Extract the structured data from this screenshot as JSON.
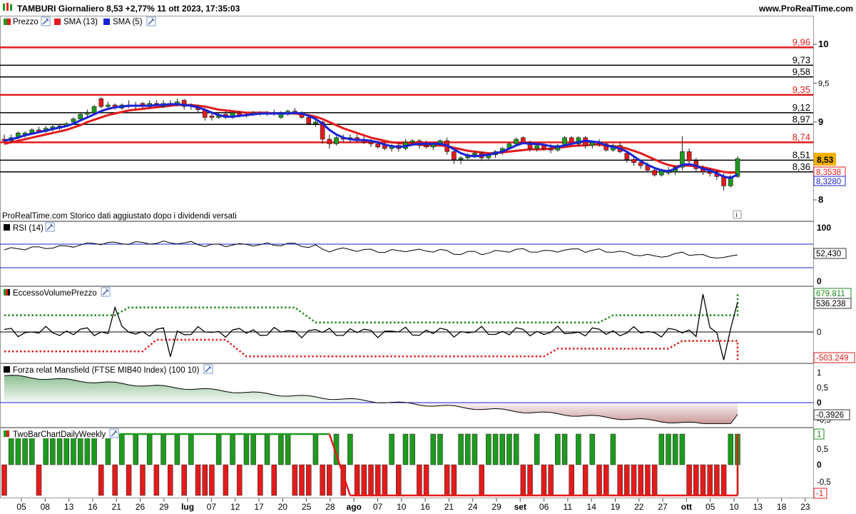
{
  "header": {
    "title": "TAMBURI Giornaliero 8,53 +2,77% 11 ott 2023, 17:35:03",
    "brand": "www.ProRealTime.com"
  },
  "legend": {
    "price": "Prezzo",
    "sma13": "SMA (13)",
    "sma5": "SMA (5)"
  },
  "note": "ProRealTime.com  Storico dati aggiustato dopo i dividendi versati",
  "colors": {
    "up": "#1e9a1e",
    "down": "#e31b1b",
    "sma13": "#e31b1b",
    "sma5": "#1a22d6",
    "neutral": "#000000",
    "green_dot": "#1e8a1e",
    "red_dot": "#e31b1b",
    "accent": "#f5b000"
  },
  "price_panel": {
    "y_ticks": [
      "10",
      "9,5",
      "9",
      "8,5",
      "8"
    ],
    "h_levels": [
      {
        "value": 9.96,
        "label": "9,96",
        "color": "red"
      },
      {
        "value": 9.73,
        "label": "9,73",
        "color": "black"
      },
      {
        "value": 9.58,
        "label": "9,58",
        "color": "black"
      },
      {
        "value": 9.35,
        "label": "9,35",
        "color": "red"
      },
      {
        "value": 9.12,
        "label": "9,12",
        "color": "black"
      },
      {
        "value": 8.97,
        "label": "8,97",
        "color": "black"
      },
      {
        "value": 8.74,
        "label": "8,74",
        "color": "red"
      },
      {
        "value": 8.51,
        "label": "8,51",
        "color": "black"
      },
      {
        "value": 8.36,
        "label": "8,36",
        "color": "black"
      }
    ],
    "last_price": "8,53",
    "sma13_value": "8,3538",
    "sma5_value": "8,3280"
  },
  "rsi": {
    "title": "RSI (14)",
    "top_label": "100",
    "bottom_label": "0",
    "value": "52,430",
    "upper_band": 70,
    "lower_band": 30
  },
  "evp": {
    "title": "EccessoVolumePrezzo",
    "upper_value": "679.811",
    "current_value": "536.238",
    "zero_label": "0",
    "lower_value": "-503.249"
  },
  "mansfield": {
    "title": "Forza relat Mansfield (FTSE MIB40 Index) (100 10)",
    "ticks": [
      "1",
      "0,5",
      "0",
      "-0,5"
    ],
    "value": "-0,3926"
  },
  "twobar": {
    "title": "TwoBarChartDailyWeekly",
    "ticks": [
      "0,5",
      "0",
      "-0,5"
    ],
    "top_value": "1",
    "bottom_value": "-1"
  },
  "x_axis": [
    "05",
    "08",
    "13",
    "16",
    "21",
    "26",
    "29",
    "lug",
    "07",
    "12",
    "17",
    "20",
    "25",
    "28",
    "ago",
    "07",
    "10",
    "16",
    "21",
    "24",
    "29",
    "set",
    "06",
    "11",
    "14",
    "19",
    "22",
    "27",
    "ott",
    "05",
    "10",
    "13",
    "18",
    "23"
  ],
  "chart_data": {
    "type": "candlestick",
    "title": "TAMBURI Giornaliero 8,53 +2,77% 11 ott 2023, 17:35:03",
    "series": [
      {
        "name": "Prezzo",
        "type": "candlestick"
      },
      {
        "name": "SMA (13)",
        "type": "line",
        "last": 8.3538
      },
      {
        "name": "SMA (5)",
        "type": "line",
        "last": 8.328
      }
    ],
    "ohlc": [
      [
        8.78,
        8.84,
        8.74,
        8.76
      ],
      [
        8.76,
        8.84,
        8.74,
        8.8
      ],
      [
        8.8,
        8.88,
        8.78,
        8.86
      ],
      [
        8.84,
        8.88,
        8.8,
        8.86
      ],
      [
        8.86,
        8.92,
        8.84,
        8.9
      ],
      [
        8.9,
        8.94,
        8.86,
        8.88
      ],
      [
        8.88,
        8.95,
        8.86,
        8.92
      ],
      [
        8.92,
        8.96,
        8.88,
        8.94
      ],
      [
        8.92,
        8.98,
        8.9,
        8.95
      ],
      [
        8.96,
        9.0,
        8.94,
        8.98
      ],
      [
        9.0,
        9.06,
        8.98,
        9.04
      ],
      [
        9.04,
        9.12,
        9.02,
        9.1
      ],
      [
        9.1,
        9.16,
        9.06,
        9.12
      ],
      [
        9.12,
        9.22,
        9.1,
        9.2
      ],
      [
        9.3,
        9.32,
        9.18,
        9.2
      ],
      [
        9.2,
        9.26,
        9.16,
        9.22
      ],
      [
        9.22,
        9.24,
        9.16,
        9.18
      ],
      [
        9.18,
        9.24,
        9.16,
        9.22
      ],
      [
        9.22,
        9.28,
        9.18,
        9.2
      ],
      [
        9.2,
        9.26,
        9.16,
        9.22
      ],
      [
        9.24,
        9.26,
        9.18,
        9.2
      ],
      [
        9.2,
        9.28,
        9.18,
        9.24
      ],
      [
        9.24,
        9.28,
        9.2,
        9.22
      ],
      [
        9.2,
        9.28,
        9.18,
        9.24
      ],
      [
        9.24,
        9.28,
        9.2,
        9.22
      ],
      [
        9.22,
        9.3,
        9.2,
        9.26
      ],
      [
        9.28,
        9.3,
        9.16,
        9.2
      ],
      [
        9.2,
        9.24,
        9.16,
        9.22
      ],
      [
        9.18,
        9.22,
        9.12,
        9.16
      ],
      [
        9.16,
        9.18,
        9.02,
        9.06
      ],
      [
        9.08,
        9.14,
        9.02,
        9.06
      ],
      [
        9.06,
        9.12,
        9.04,
        9.08
      ],
      [
        9.1,
        9.14,
        9.04,
        9.06
      ],
      [
        9.06,
        9.14,
        9.04,
        9.12
      ],
      [
        9.12,
        9.14,
        9.06,
        9.08
      ],
      [
        9.08,
        9.12,
        9.06,
        9.1
      ],
      [
        9.1,
        9.14,
        9.08,
        9.12
      ],
      [
        9.12,
        9.14,
        9.08,
        9.1
      ],
      [
        9.1,
        9.14,
        9.08,
        9.12
      ],
      [
        9.12,
        9.16,
        9.08,
        9.1
      ],
      [
        9.06,
        9.14,
        9.04,
        9.12
      ],
      [
        9.12,
        9.16,
        9.08,
        9.14
      ],
      [
        9.14,
        9.18,
        9.1,
        9.12
      ],
      [
        9.12,
        9.14,
        9.04,
        9.06
      ],
      [
        9.06,
        9.1,
        8.96,
        8.98
      ],
      [
        8.98,
        9.04,
        8.94,
        9.0
      ],
      [
        9.0,
        9.02,
        8.72,
        8.78
      ],
      [
        8.78,
        8.84,
        8.66,
        8.72
      ],
      [
        8.72,
        8.82,
        8.7,
        8.8
      ],
      [
        8.8,
        8.84,
        8.74,
        8.78
      ],
      [
        8.78,
        8.84,
        8.74,
        8.8
      ],
      [
        8.8,
        8.84,
        8.74,
        8.76
      ],
      [
        8.76,
        8.82,
        8.72,
        8.74
      ],
      [
        8.74,
        8.78,
        8.68,
        8.72
      ],
      [
        8.72,
        8.76,
        8.66,
        8.68
      ],
      [
        8.7,
        8.74,
        8.64,
        8.66
      ],
      [
        8.66,
        8.72,
        8.62,
        8.7
      ],
      [
        8.7,
        8.74,
        8.62,
        8.66
      ],
      [
        8.66,
        8.78,
        8.64,
        8.74
      ],
      [
        8.74,
        8.78,
        8.7,
        8.76
      ],
      [
        8.76,
        8.78,
        8.66,
        8.7
      ],
      [
        8.7,
        8.76,
        8.66,
        8.68
      ],
      [
        8.68,
        8.74,
        8.64,
        8.72
      ],
      [
        8.72,
        8.78,
        8.7,
        8.76
      ],
      [
        8.76,
        8.8,
        8.58,
        8.62
      ],
      [
        8.62,
        8.64,
        8.46,
        8.52
      ],
      [
        8.52,
        8.56,
        8.46,
        8.54
      ],
      [
        8.54,
        8.6,
        8.52,
        8.58
      ],
      [
        8.58,
        8.62,
        8.54,
        8.6
      ],
      [
        8.6,
        8.62,
        8.5,
        8.54
      ],
      [
        8.54,
        8.6,
        8.52,
        8.58
      ],
      [
        8.58,
        8.64,
        8.54,
        8.62
      ],
      [
        8.62,
        8.68,
        8.58,
        8.66
      ],
      [
        8.66,
        8.74,
        8.64,
        8.72
      ],
      [
        8.72,
        8.8,
        8.7,
        8.78
      ],
      [
        8.8,
        8.82,
        8.72,
        8.74
      ],
      [
        8.74,
        8.76,
        8.62,
        8.66
      ],
      [
        8.66,
        8.72,
        8.62,
        8.7
      ],
      [
        8.7,
        8.72,
        8.64,
        8.66
      ],
      [
        8.66,
        8.72,
        8.6,
        8.64
      ],
      [
        8.64,
        8.72,
        8.62,
        8.7
      ],
      [
        8.7,
        8.82,
        8.68,
        8.8
      ],
      [
        8.8,
        8.82,
        8.7,
        8.72
      ],
      [
        8.72,
        8.82,
        8.68,
        8.8
      ],
      [
        8.8,
        8.82,
        8.66,
        8.7
      ],
      [
        8.7,
        8.76,
        8.66,
        8.74
      ],
      [
        8.74,
        8.78,
        8.68,
        8.72
      ],
      [
        8.72,
        8.74,
        8.62,
        8.64
      ],
      [
        8.64,
        8.72,
        8.62,
        8.7
      ],
      [
        8.7,
        8.74,
        8.6,
        8.62
      ],
      [
        8.6,
        8.62,
        8.48,
        8.52
      ],
      [
        8.52,
        8.56,
        8.44,
        8.48
      ],
      [
        8.48,
        8.52,
        8.4,
        8.44
      ],
      [
        8.44,
        8.48,
        8.36,
        8.38
      ],
      [
        8.38,
        8.42,
        8.3,
        8.32
      ],
      [
        8.32,
        8.4,
        8.3,
        8.38
      ],
      [
        8.36,
        8.42,
        8.32,
        8.36
      ],
      [
        8.36,
        8.44,
        8.32,
        8.42
      ],
      [
        8.42,
        8.82,
        8.38,
        8.62
      ],
      [
        8.62,
        8.66,
        8.46,
        8.5
      ],
      [
        8.5,
        8.54,
        8.36,
        8.4
      ],
      [
        8.4,
        8.44,
        8.32,
        8.36
      ],
      [
        8.36,
        8.4,
        8.3,
        8.34
      ],
      [
        8.34,
        8.38,
        8.26,
        8.3
      ],
      [
        8.3,
        8.34,
        8.12,
        8.18
      ],
      [
        8.18,
        8.32,
        8.16,
        8.3
      ],
      [
        8.3,
        8.56,
        8.28,
        8.53
      ]
    ],
    "sma13": [
      8.72,
      8.74,
      8.76,
      8.78,
      8.8,
      8.82,
      8.84,
      8.86,
      8.88,
      8.9,
      8.93,
      8.96,
      9.0,
      9.03,
      9.06,
      9.09,
      9.11,
      9.13,
      9.15,
      9.16,
      9.17,
      9.18,
      9.19,
      9.2,
      9.21,
      9.22,
      9.22,
      9.22,
      9.21,
      9.2,
      9.18,
      9.16,
      9.15,
      9.14,
      9.13,
      9.12,
      9.12,
      9.12,
      9.12,
      9.11,
      9.11,
      9.11,
      9.11,
      9.1,
      9.09,
      9.07,
      9.04,
      9.0,
      8.96,
      8.92,
      8.89,
      8.86,
      8.83,
      8.8,
      8.78,
      8.76,
      8.74,
      8.73,
      8.72,
      8.72,
      8.71,
      8.7,
      8.7,
      8.7,
      8.69,
      8.67,
      8.65,
      8.63,
      8.62,
      8.61,
      8.6,
      8.6,
      8.61,
      8.62,
      8.63,
      8.64,
      8.65,
      8.65,
      8.65,
      8.66,
      8.67,
      8.68,
      8.69,
      8.7,
      8.7,
      8.71,
      8.71,
      8.7,
      8.69,
      8.68,
      8.66,
      8.63,
      8.6,
      8.56,
      8.52,
      8.48,
      8.45,
      8.43,
      8.44,
      8.44,
      8.43,
      8.42,
      8.4,
      8.38,
      8.36,
      8.35,
      8.3538
    ],
    "sma5": [
      8.76,
      8.78,
      8.8,
      8.83,
      8.85,
      8.87,
      8.89,
      8.91,
      8.93,
      8.95,
      8.98,
      9.02,
      9.06,
      9.1,
      9.14,
      9.17,
      9.19,
      9.2,
      9.21,
      9.21,
      9.21,
      9.21,
      9.22,
      9.22,
      9.23,
      9.23,
      9.22,
      9.21,
      9.19,
      9.16,
      9.12,
      9.09,
      9.07,
      9.07,
      9.08,
      9.09,
      9.1,
      9.11,
      9.11,
      9.11,
      9.11,
      9.11,
      9.12,
      9.11,
      9.08,
      9.04,
      8.98,
      8.9,
      8.84,
      8.8,
      8.78,
      8.77,
      8.77,
      8.76,
      8.74,
      8.71,
      8.69,
      8.68,
      8.69,
      8.71,
      8.72,
      8.72,
      8.72,
      8.72,
      8.7,
      8.65,
      8.6,
      8.57,
      8.56,
      8.57,
      8.58,
      8.6,
      8.62,
      8.66,
      8.7,
      8.73,
      8.72,
      8.72,
      8.71,
      8.69,
      8.68,
      8.7,
      8.72,
      8.74,
      8.76,
      8.75,
      8.74,
      8.7,
      8.68,
      8.66,
      8.62,
      8.56,
      8.5,
      8.45,
      8.41,
      8.38,
      8.37,
      8.4,
      8.45,
      8.46,
      8.44,
      8.4,
      8.38,
      8.34,
      8.3,
      8.28,
      8.328
    ],
    "y_range": [
      7.85,
      10.25
    ]
  }
}
